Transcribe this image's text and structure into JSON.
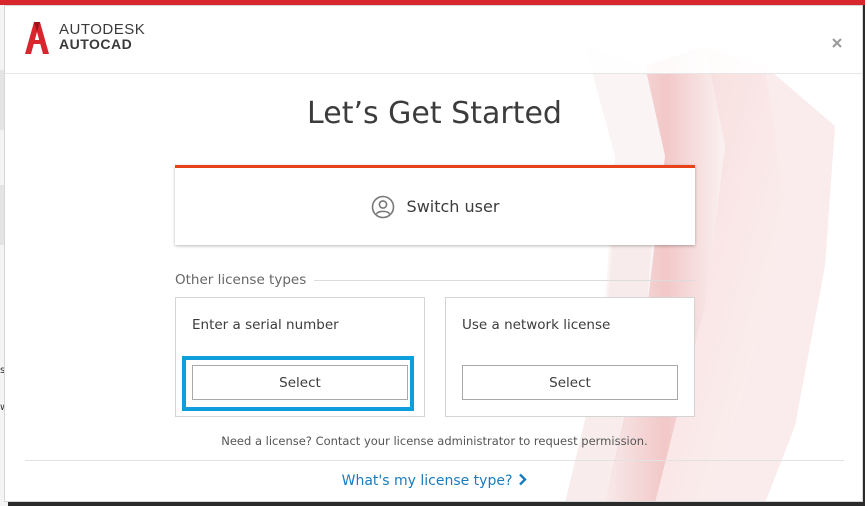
{
  "app": {
    "brand_line1": "AUTODESK",
    "brand_line2": "AUTOCAD",
    "close_glyph": "×"
  },
  "main": {
    "title": "Let’s Get Started",
    "switch_user_label": "Switch user",
    "other_license_label": "Other license types",
    "cards": [
      {
        "title": "Enter a serial number",
        "button_label": "Select",
        "focused": true
      },
      {
        "title": "Use a network license",
        "button_label": "Select",
        "focused": false
      }
    ],
    "need_license_text": "Need a license? Contact your license administrator to request permission.",
    "license_link_text": "What's my license type?"
  },
  "background": {
    "left_glyphs": [
      "s",
      "w"
    ]
  },
  "colors": {
    "accent_red": "#e8421b",
    "top_bar_red": "#d8262e",
    "focus_blue": "#0e9edb",
    "link_blue": "#1a7bbd"
  },
  "icons": {
    "logo": "autodesk-a-logo-icon",
    "close": "close-icon",
    "user": "user-circle-icon",
    "chevron": "chevron-right-icon"
  }
}
